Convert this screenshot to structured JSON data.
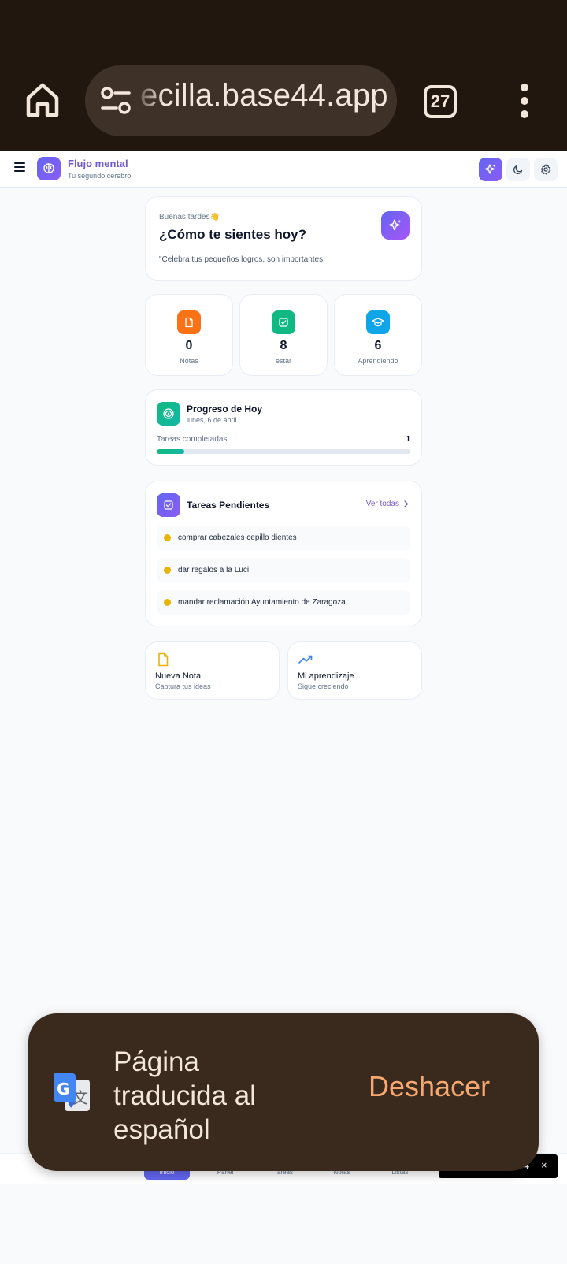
{
  "browser": {
    "url_text": "ecilla.base44.app",
    "tab_count": "27"
  },
  "header": {
    "title": "Flujo mental",
    "subtitle": "Tu segundo cerebro"
  },
  "greeting": {
    "small": "Buenas tardes👋",
    "title": "¿Cómo te sientes hoy?",
    "quote": "\"Celebra tus pequeños logros, son importantes."
  },
  "stats": [
    {
      "value": "0",
      "label": "Notas",
      "color": "#f97316",
      "icon": "file-icon"
    },
    {
      "value": "8",
      "label": "estar",
      "color": "#10b981",
      "icon": "check-square-icon"
    },
    {
      "value": "6",
      "label": "Aprendiendo",
      "color": "#0ea5e9",
      "icon": "graduation-cap-icon"
    }
  ],
  "progress": {
    "title": "Progreso de Hoy",
    "date": "lunes, 6 de abril",
    "label": "Tareas completadas",
    "count": "1",
    "fraction": 0.11
  },
  "tasks": {
    "title": "Tareas Pendientes",
    "link": "Ver todas",
    "items": [
      "comprar cabezales cepillo dientes",
      "dar regalos a la Luci",
      "mandar reclamación Ayuntamiento de Zaragoza"
    ]
  },
  "quick": [
    {
      "title": "Nueva Nota",
      "subtitle": "Captura tus ideas",
      "icon": "file-icon"
    },
    {
      "title": "Mi aprendizaje",
      "subtitle": "Sigue creciendo",
      "icon": "trending-up-icon"
    }
  ],
  "nav": {
    "items": [
      "Inicio",
      "Panel",
      "Tareas",
      "Notas",
      "Listas"
    ],
    "active": "Inicio"
  },
  "chip": {
    "text": "4",
    "close": "×"
  },
  "snackbar": {
    "message": "Página traducida al español",
    "action": "Deshacer"
  },
  "colors": {
    "accent": "#6366f1",
    "browser_bg": "#22170f",
    "snackbar_bg": "#3a2a1e",
    "snackbar_action": "#f7a870"
  }
}
